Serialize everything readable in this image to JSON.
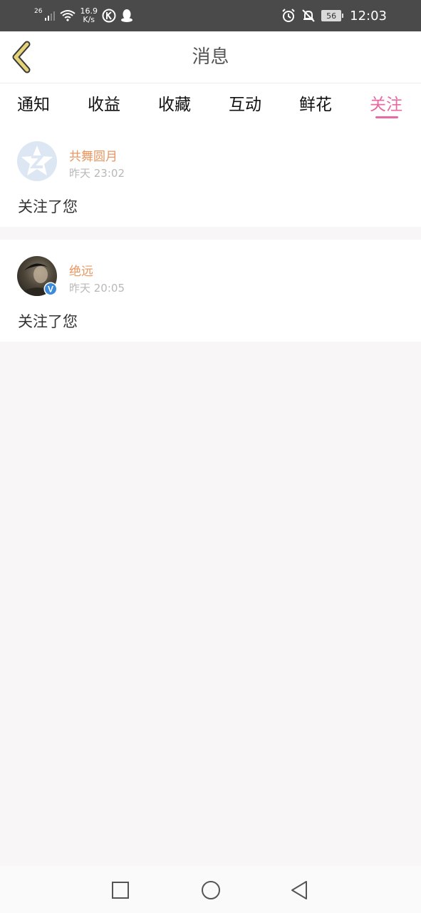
{
  "status_bar": {
    "signal_label": "26",
    "speed_value": "16.9",
    "speed_unit": "K/s",
    "battery": "56",
    "time": "12:03"
  },
  "header": {
    "title": "消息"
  },
  "tabs": [
    {
      "label": "通知",
      "active": false
    },
    {
      "label": "收益",
      "active": false
    },
    {
      "label": "收藏",
      "active": false
    },
    {
      "label": "互动",
      "active": false
    },
    {
      "label": "鲜花",
      "active": false
    },
    {
      "label": "关注",
      "active": true
    }
  ],
  "messages": [
    {
      "name": "共舞圆月",
      "time": "昨天 23:02",
      "text": "关注了您",
      "avatar": "default-star-avatar",
      "verified": false
    },
    {
      "name": "绝远",
      "time": "昨天 20:05",
      "text": "关注了您",
      "avatar": "photo-avatar",
      "verified": true
    }
  ],
  "verified_badge": "V",
  "colors": {
    "accent": "#e86aa4",
    "name": "#e99660",
    "back_arrow": "#e5d37a"
  }
}
